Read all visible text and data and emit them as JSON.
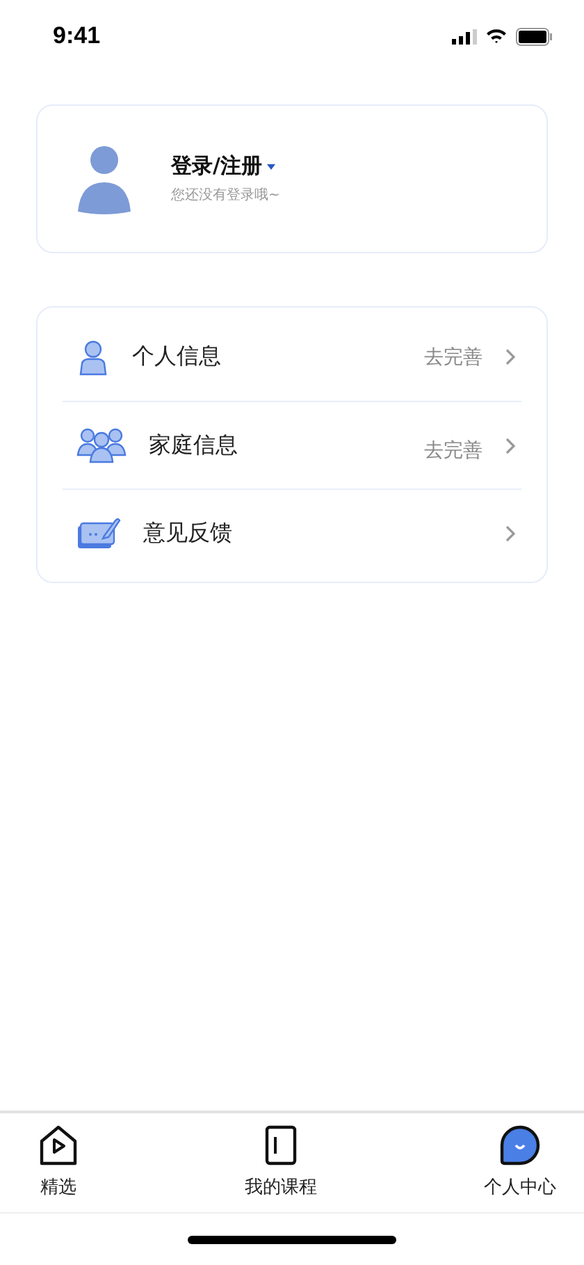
{
  "status_bar": {
    "time": "9:41"
  },
  "profile": {
    "title": "登录/注册",
    "subtitle": "您还没有登录哦~"
  },
  "menu": [
    {
      "label": "个人信息",
      "action": "去完善"
    },
    {
      "label": "家庭信息",
      "action": "去完善"
    },
    {
      "label": "意见反馈"
    }
  ],
  "tab_bar": [
    {
      "label": "精选",
      "selected": false
    },
    {
      "label": "我的课程",
      "selected": false
    },
    {
      "label": "个人中心",
      "selected": true
    }
  ]
}
